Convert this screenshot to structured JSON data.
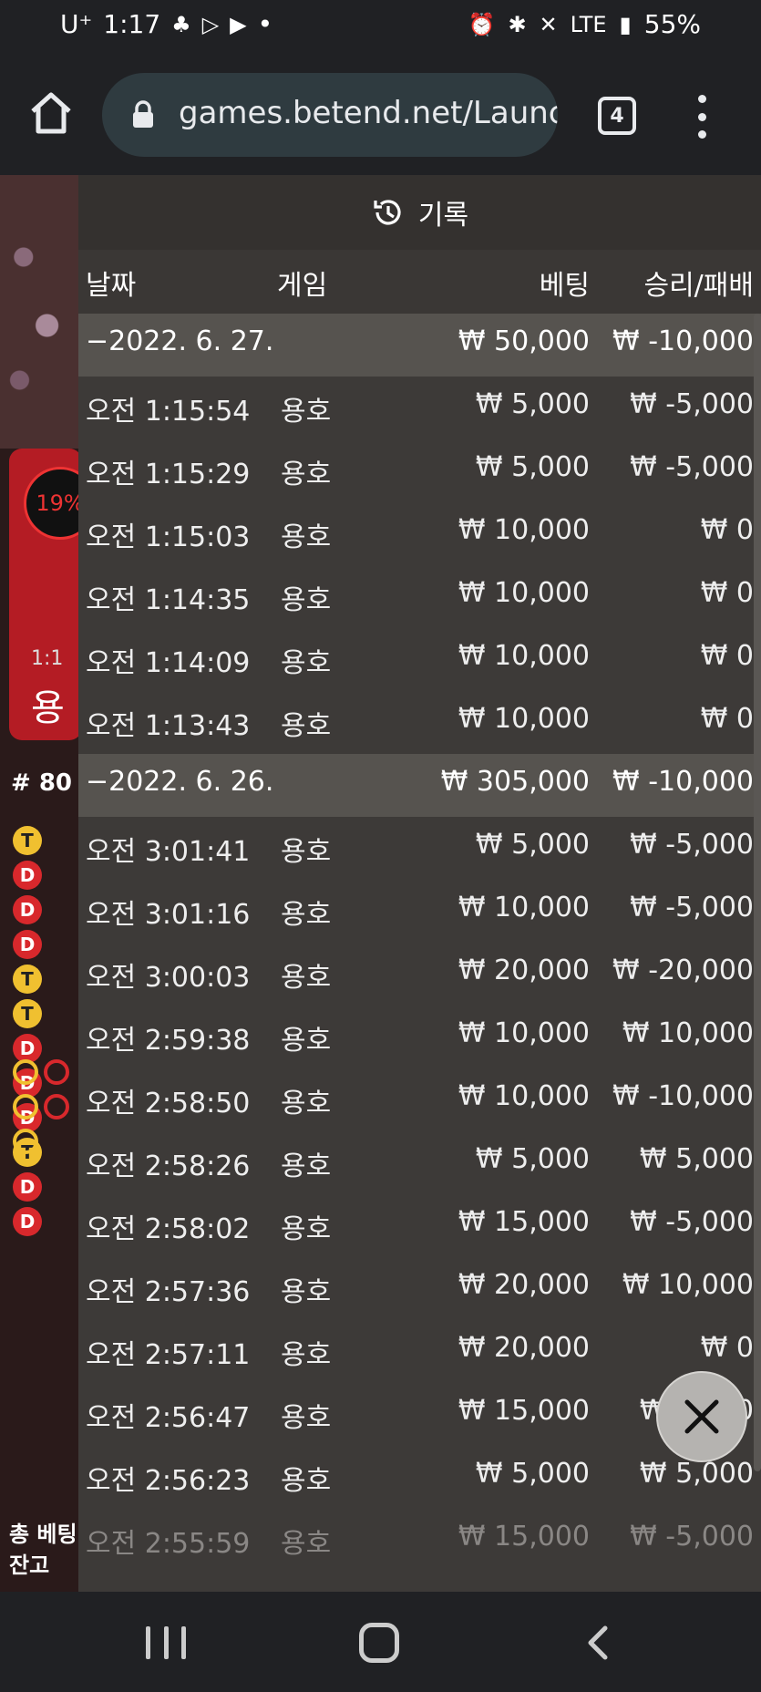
{
  "status_bar": {
    "carrier": "U⁺",
    "time": "1:17",
    "dot": "•",
    "network": "LTE",
    "battery": "55%"
  },
  "browser": {
    "url": "games.betend.net/Launc",
    "tab_count": "4"
  },
  "game_bg": {
    "percent": "19%",
    "odds": "1:1",
    "dragon": "용",
    "round": "# 80",
    "beads": [
      "T",
      "D",
      "D",
      "D",
      "T",
      "T",
      "D",
      "D",
      "D",
      "T",
      "D",
      "D"
    ],
    "total_bet_label": "총 베팅",
    "balance_label": "잔고"
  },
  "panel": {
    "title": "기록",
    "columns": {
      "date": "날짜",
      "game": "게임",
      "bet": "베팅",
      "win_loss": "승리/패배"
    },
    "rows": [
      {
        "type": "group",
        "date": "−2022. 6. 27.",
        "bet": "₩ 50,000",
        "win": "₩ -10,000"
      },
      {
        "type": "item",
        "date": "오전 1:15:54",
        "game": "용호",
        "bet": "₩ 5,000",
        "win": "₩ -5,000"
      },
      {
        "type": "item",
        "date": "오전 1:15:29",
        "game": "용호",
        "bet": "₩ 5,000",
        "win": "₩ -5,000"
      },
      {
        "type": "item",
        "date": "오전 1:15:03",
        "game": "용호",
        "bet": "₩ 10,000",
        "win": "₩ 0"
      },
      {
        "type": "item",
        "date": "오전 1:14:35",
        "game": "용호",
        "bet": "₩ 10,000",
        "win": "₩ 0"
      },
      {
        "type": "item",
        "date": "오전 1:14:09",
        "game": "용호",
        "bet": "₩ 10,000",
        "win": "₩ 0"
      },
      {
        "type": "item",
        "date": "오전 1:13:43",
        "game": "용호",
        "bet": "₩ 10,000",
        "win": "₩ 0"
      },
      {
        "type": "group",
        "date": "−2022. 6. 26.",
        "bet": "₩ 305,000",
        "win": "₩ -10,000"
      },
      {
        "type": "item",
        "date": "오전 3:01:41",
        "game": "용호",
        "bet": "₩ 5,000",
        "win": "₩ -5,000"
      },
      {
        "type": "item",
        "date": "오전 3:01:16",
        "game": "용호",
        "bet": "₩ 10,000",
        "win": "₩ -5,000"
      },
      {
        "type": "item",
        "date": "오전 3:00:03",
        "game": "용호",
        "bet": "₩ 20,000",
        "win": "₩ -20,000"
      },
      {
        "type": "item",
        "date": "오전 2:59:38",
        "game": "용호",
        "bet": "₩ 10,000",
        "win": "₩ 10,000"
      },
      {
        "type": "item",
        "date": "오전 2:58:50",
        "game": "용호",
        "bet": "₩ 10,000",
        "win": "₩ -10,000"
      },
      {
        "type": "item",
        "date": "오전 2:58:26",
        "game": "용호",
        "bet": "₩ 5,000",
        "win": "₩ 5,000"
      },
      {
        "type": "item",
        "date": "오전 2:58:02",
        "game": "용호",
        "bet": "₩ 15,000",
        "win": "₩ -5,000"
      },
      {
        "type": "item",
        "date": "오전 2:57:36",
        "game": "용호",
        "bet": "₩ 20,000",
        "win": "₩ 10,000"
      },
      {
        "type": "item",
        "date": "오전 2:57:11",
        "game": "용호",
        "bet": "₩ 20,000",
        "win": "₩ 0"
      },
      {
        "type": "item",
        "date": "오전 2:56:47",
        "game": "용호",
        "bet": "₩ 15,000",
        "win": "₩ 5,000"
      },
      {
        "type": "item",
        "date": "오전 2:56:23",
        "game": "용호",
        "bet": "₩ 5,000",
        "win": "₩ 5,000"
      },
      {
        "type": "faded",
        "date": "오전 2:55:59",
        "game": "용호",
        "bet": "₩ 15,000",
        "win": "₩ -5,000"
      }
    ]
  },
  "icons": {
    "home": "home-icon",
    "lock": "lock-icon",
    "history": "history-icon",
    "close": "close-icon"
  }
}
